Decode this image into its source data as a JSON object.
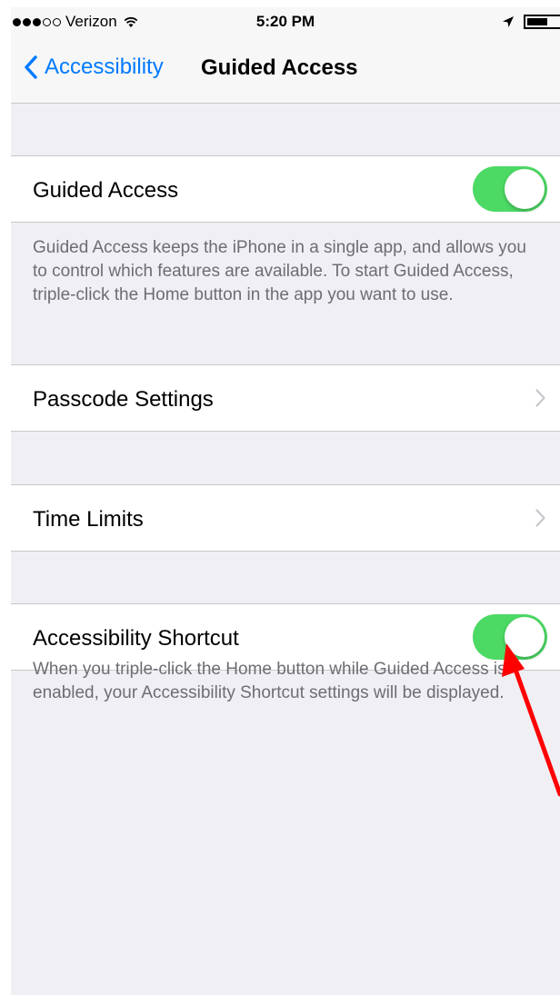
{
  "status_bar": {
    "signal_full": 3,
    "signal_empty": 2,
    "carrier": "Verizon",
    "time": "5:20 PM",
    "location_icon": "location-arrow-icon",
    "wifi_icon": "wifi-icon",
    "battery_icon": "battery-icon"
  },
  "nav": {
    "back_label": "Accessibility",
    "title": "Guided Access"
  },
  "guided_access": {
    "label": "Guided Access",
    "enabled": true,
    "footer": "Guided Access keeps the iPhone in a single app, and allows you to control which features are available. To start Guided Access, triple-click the Home button in the app you want to use."
  },
  "passcode_settings": {
    "label": "Passcode Settings"
  },
  "time_limits": {
    "label": "Time Limits"
  },
  "accessibility_shortcut": {
    "label": "Accessibility Shortcut",
    "enabled": true,
    "footer": "When you triple-click the Home button while Guided Access is enabled, your Accessibility Shortcut settings will be displayed."
  },
  "colors": {
    "accent": "#007aff",
    "toggle_on": "#4cd964",
    "annotation_arrow": "#ff0000"
  }
}
